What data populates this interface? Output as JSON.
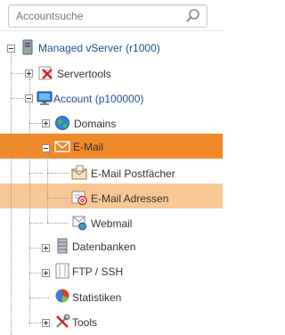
{
  "search": {
    "placeholder": "Accountsuche"
  },
  "tree": {
    "root": {
      "label": "Managed vServer (r1000)",
      "icon": "server-icon"
    },
    "servertools": {
      "label": "Servertools",
      "icon": "servertools-icon"
    },
    "account": {
      "label": "Account (p100000)",
      "icon": "monitor-icon"
    },
    "domains": {
      "label": "Domains",
      "icon": "globe-icon"
    },
    "email": {
      "label": "E-Mail",
      "icon": "envelope-icon"
    },
    "postfaecher": {
      "label": "E-Mail Postfächer",
      "icon": "mailbox-icon"
    },
    "adressen": {
      "label": "E-Mail Adressen",
      "icon": "email-address-icon"
    },
    "webmail": {
      "label": "Webmail",
      "icon": "webmail-icon"
    },
    "datenbanken": {
      "label": "Datenbanken",
      "icon": "database-icon"
    },
    "ftp": {
      "label": "FTP / SSH",
      "icon": "ftp-icon"
    },
    "statistiken": {
      "label": "Statistiken",
      "icon": "pie-chart-icon"
    },
    "tools": {
      "label": "Tools",
      "icon": "tools-icon"
    }
  },
  "colors": {
    "active": "#f0892a",
    "selected": "#f8c796",
    "link": "#1f4f8c"
  }
}
